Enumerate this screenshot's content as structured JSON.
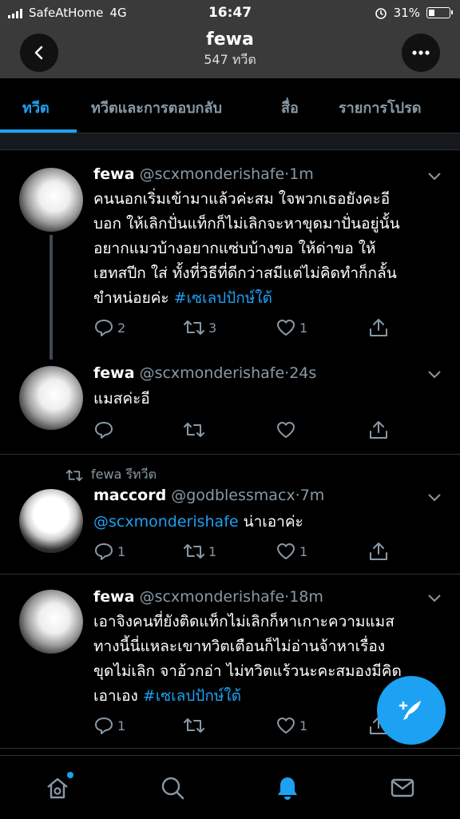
{
  "status_bar": {
    "carrier": "SafeAtHome",
    "network": "4G",
    "time": "16:47",
    "battery": "31%",
    "battery_level": 0.31
  },
  "header": {
    "name": "fewa",
    "tweet_count": "547 ทวีต"
  },
  "tabs": [
    {
      "label": "ทวีต",
      "active": true
    },
    {
      "label": "ทวีตและการตอบกลับ",
      "active": false
    },
    {
      "label": "สื่อ",
      "active": false
    },
    {
      "label": "รายการโปรด",
      "active": false
    }
  ],
  "tweets": [
    {
      "name": "fewa",
      "handle": "@scxmonderishafe",
      "time": "1m",
      "lines": [
        "คนนอกเริ่มเข้ามาแล้วค่ะสม ใจพวกเธอยังคะอี",
        "บอก ให้เลิกปั่นแท็กก็ไม่เลิกจะหาขุดมาปั่นอยู่นั้น",
        "อยากแมวบ้างอยากแซ่บบ้างขอ ให้ด่าขอ ให้",
        "เฮทสปีก ใส่ ทั้งที่วิธีที่ดีกว่าสมีแต่ไม่คิดทำก็กลั้น",
        "ขำหน่อยค่ะ "
      ],
      "hashtag": "#เซเลปปักษ์ใต้",
      "reply": "2",
      "retweet": "3",
      "like": "1"
    },
    {
      "name": "fewa",
      "handle": "@scxmonderishafe",
      "time": "24s",
      "text": "แมสค่ะอี",
      "reply": "",
      "retweet": "",
      "like": ""
    },
    {
      "retweeted_by": "fewa รีทวีต",
      "name": "maccord",
      "handle": "@godblessmacx",
      "time": "7m",
      "mention": "@scxmonderishafe",
      "text": " น่าเอาค่ะ",
      "reply": "1",
      "retweet": "1",
      "like": "1"
    },
    {
      "name": "fewa",
      "handle": "@scxmonderishafe",
      "time": "18m",
      "lines": [
        "เอาจิงคนที่ยังติดแท็กไม่เลิกก็หาเกาะความแมส",
        "ทางนี้นี่แหละเขาทวิตเตือนก็ไม่อ่านจ้าหาเรื่อง",
        "ขุดไม่เลิก จาอ้วกอ่า ไม่ทวิตแร้วนะคะสมองมีคิด",
        "เอาเอง "
      ],
      "hashtag": "#เซเลปปักษ์ใต้",
      "reply": "1",
      "retweet": "",
      "like": "1"
    }
  ],
  "icons": {
    "back": "back-arrow-icon",
    "more": "more-icon",
    "reply": "reply-icon",
    "retweet": "retweet-icon",
    "like": "heart-icon",
    "share": "share-icon",
    "compose": "compose-tweet-icon",
    "home": "home-icon",
    "search": "search-icon",
    "notifications": "bell-icon",
    "messages": "mail-icon"
  },
  "colors": {
    "accent": "#1da1f2",
    "muted": "#8899a6",
    "background": "#000000",
    "header": "#3a3a3a"
  }
}
